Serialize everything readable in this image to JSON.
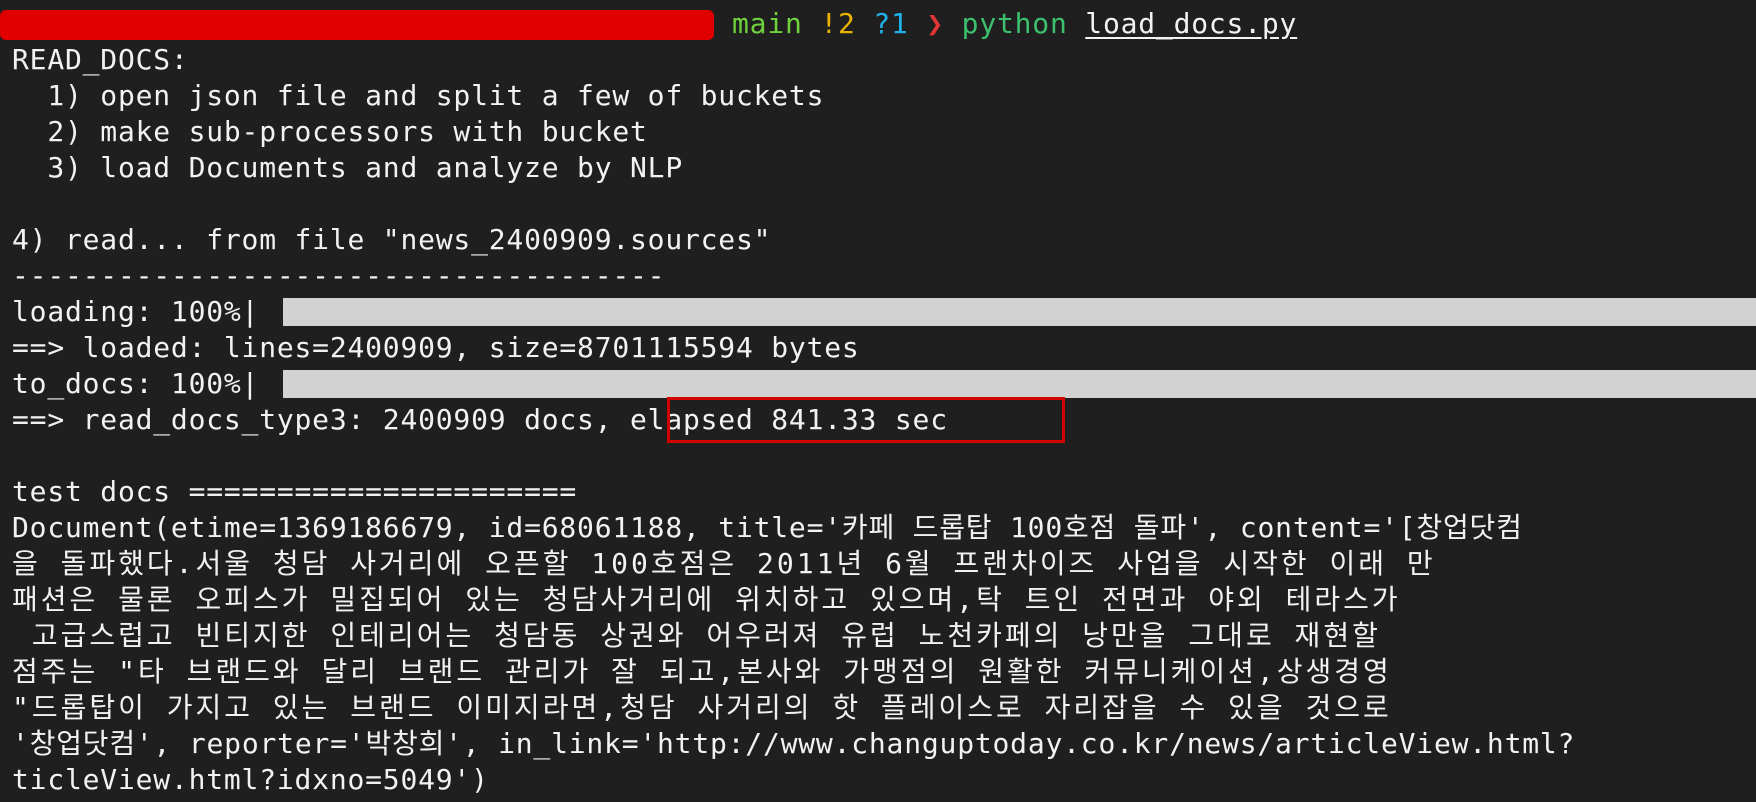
{
  "prompt": {
    "branch": "main",
    "changes": "!2",
    "untracked": "?1",
    "arrow": "❯",
    "command": "python",
    "argument": "load_docs.py"
  },
  "output": {
    "header": "READ_DOCS:",
    "step1": "  1) open json file and split a few of buckets",
    "step2": "  2) make sub-processors with bucket",
    "step3": "  3) load Documents and analyze by NLP",
    "step4": "4) read... from file \"news_2400909.sources\"",
    "divider": "-------------------------------------",
    "loading_label": "loading: 100%|",
    "loaded_line": "==> loaded: lines=2400909, size=8701115594 bytes",
    "to_docs_label": "to_docs: 100%|",
    "read_docs_prefix": "==> read_docs_type3: 2400909 docs, ",
    "elapsed": "elapsed 841.33 sec",
    "test_docs": "test docs ======================",
    "doc_lines": [
      "Document(etime=1369186679, id=68061188, title='카페 드롭탑 100호점 돌파', content='[창업닷컴",
      "을 돌파했다.서울 청담 사거리에 오픈할 100호점은 2011년 6월 프랜차이즈 사업을 시작한 이래 만",
      "패션은 물론 오피스가 밀집되어 있는 청담사거리에 위치하고 있으며,탁 트인 전면과 야외 테라스가",
      " 고급스럽고 빈티지한 인테리어는 청담동 상권와 어우러져 유럽 노천카페의 낭만을 그대로 재현할 ",
      "점주는 \"타 브랜드와 달리 브랜드 관리가 잘 되고,본사와 가맹점의 원활한 커뮤니케이션,상생경영",
      "\"드롭탑이 가지고 있는 브랜드 이미지라면,청담 사거리의 핫 플레이스로 자리잡을 수 있을 것으로",
      "'창업닷컴', reporter='박창희', in_link='http://www.changuptoday.co.kr/news/articleView.html?",
      "ticleView.html?idxno=5049')",
      "                                       ▁ ▂▁ ▁ ▁▂▁ ▁▁ ▂ ▁▁▁▁▁ ▁ ▁▁"
    ]
  }
}
